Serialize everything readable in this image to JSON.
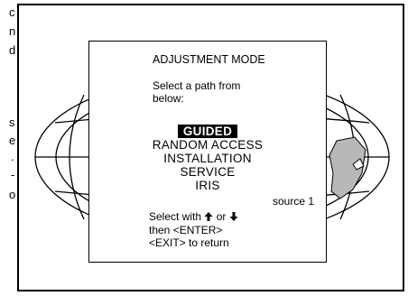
{
  "side_text": {
    "left_lines": [
      "c",
      "n",
      "d",
      "s",
      "e",
      ".",
      "-",
      "o"
    ]
  },
  "menu": {
    "title": "ADJUSTMENT MODE",
    "prompt_line1": "Select a path from",
    "prompt_line2": "below:",
    "items": [
      {
        "label": "GUIDED",
        "selected": true
      },
      {
        "label": "RANDOM ACCESS",
        "selected": false
      },
      {
        "label": "INSTALLATION",
        "selected": false
      },
      {
        "label": "SERVICE",
        "selected": false
      },
      {
        "label": "IRIS",
        "selected": false
      }
    ],
    "source": "source 1",
    "help_select_prefix": "Select with",
    "help_select_or": "or",
    "help_enter": "then <ENTER>",
    "help_exit": "<EXIT> to return"
  },
  "icons": [
    "up-arrow-icon",
    "down-arrow-icon",
    "globe-background"
  ],
  "colors": {
    "background": "#ffffff",
    "foreground": "#000000",
    "selection_bg": "#000000",
    "selection_fg": "#ffffff",
    "continent": "#b8b8b8"
  }
}
